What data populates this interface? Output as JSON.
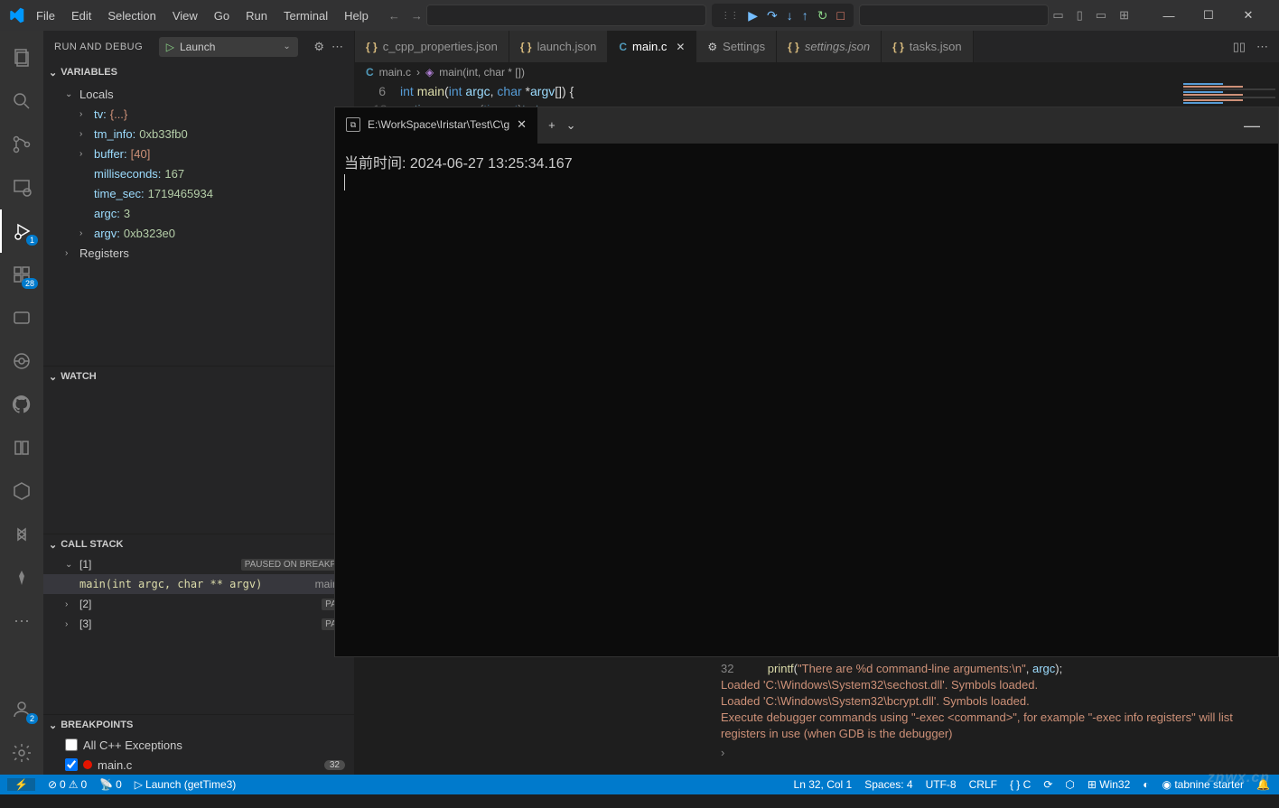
{
  "menubar": [
    "File",
    "Edit",
    "Selection",
    "View",
    "Go",
    "Run",
    "Terminal",
    "Help"
  ],
  "debugToolbar": {
    "continue": "▶",
    "stepOver": "↷",
    "stepInto": "↓",
    "stepOut": "↑",
    "restart": "↻",
    "stop": "□"
  },
  "sidebar": {
    "title": "RUN AND DEBUG",
    "launchConfig": "Launch",
    "sections": {
      "variables": {
        "title": "VARIABLES",
        "locals": {
          "label": "Locals",
          "items": [
            {
              "name": "tv:",
              "value": "{...}",
              "expandable": true
            },
            {
              "name": "tm_info:",
              "value": "0xb33fb0",
              "expandable": true
            },
            {
              "name": "buffer:",
              "value": "[40]",
              "expandable": true
            },
            {
              "name": "milliseconds:",
              "value": "167",
              "expandable": false
            },
            {
              "name": "time_sec:",
              "value": "1719465934",
              "expandable": false
            },
            {
              "name": "argc:",
              "value": "3",
              "expandable": false
            },
            {
              "name": "argv:",
              "value": "0xb323e0",
              "expandable": true
            }
          ]
        },
        "registers": {
          "label": "Registers"
        }
      },
      "watch": {
        "title": "WATCH"
      },
      "callstack": {
        "title": "CALL STACK",
        "threads": [
          {
            "id": "[1]",
            "status": "PAUSED ON BREAKPO",
            "expanded": true,
            "frames": [
              {
                "fn": "main(int argc, char ** argv)",
                "file": "main.c"
              }
            ]
          },
          {
            "id": "[2]",
            "status": "PAU",
            "expanded": false
          },
          {
            "id": "[3]",
            "status": "PAU",
            "expanded": false
          }
        ]
      },
      "breakpoints": {
        "title": "BREAKPOINTS",
        "items": [
          {
            "checked": false,
            "label": "All C++ Exceptions"
          },
          {
            "checked": true,
            "label": "main.c",
            "count": "32",
            "dot": true
          }
        ]
      }
    }
  },
  "tabs": [
    {
      "label": "c_cpp_properties.json",
      "icon": "braces",
      "active": false
    },
    {
      "label": "launch.json",
      "icon": "braces",
      "active": false
    },
    {
      "label": "main.c",
      "icon": "c",
      "active": true,
      "close": true
    },
    {
      "label": "Settings",
      "icon": "settings",
      "active": false
    },
    {
      "label": "settings.json",
      "icon": "braces",
      "active": false,
      "italic": true
    },
    {
      "label": "tasks.json",
      "icon": "braces",
      "active": false
    }
  ],
  "breadcrumb": {
    "file": "main.c",
    "symbol": "main(int, char * [])"
  },
  "code": {
    "line6": {
      "num": "6",
      "text": "int main(int argc, char *argv[]) {"
    },
    "line13": {
      "num": "13",
      "text": "    time_sec = (time_t)tv tv sec;"
    }
  },
  "terminal": {
    "tabTitle": "E:\\WorkSpace\\Iristar\\Test\\C\\g",
    "output": "当前时间: 2024-06-27 13:25:34.167"
  },
  "debugConsole": {
    "line1_num": "32",
    "line1_code": "printf(\"There are %d command-line arguments:\\n\", argc);",
    "line2": "Loaded 'C:\\Windows\\System32\\sechost.dll'. Symbols loaded.",
    "line3": "Loaded 'C:\\Windows\\System32\\bcrypt.dll'. Symbols loaded.",
    "line4": "Execute debugger commands using \"-exec <command>\", for example \"-exec info registers\" will list registers in use (when GDB is the debugger)"
  },
  "statusbar": {
    "errors": "0",
    "warnings": "0",
    "ports": "0",
    "debugLaunch": "Launch (getTime3)",
    "position": "Ln 32, Col 1",
    "spaces": "Spaces: 4",
    "encoding": "UTF-8",
    "eol": "CRLF",
    "lang": "{ } C",
    "platform": "Win32",
    "tabnine": "tabnine starter"
  },
  "activitybar": {
    "debugBadge": "1",
    "extBadge": "28",
    "accountBadge": "2"
  },
  "watermark": "znwx.cn"
}
